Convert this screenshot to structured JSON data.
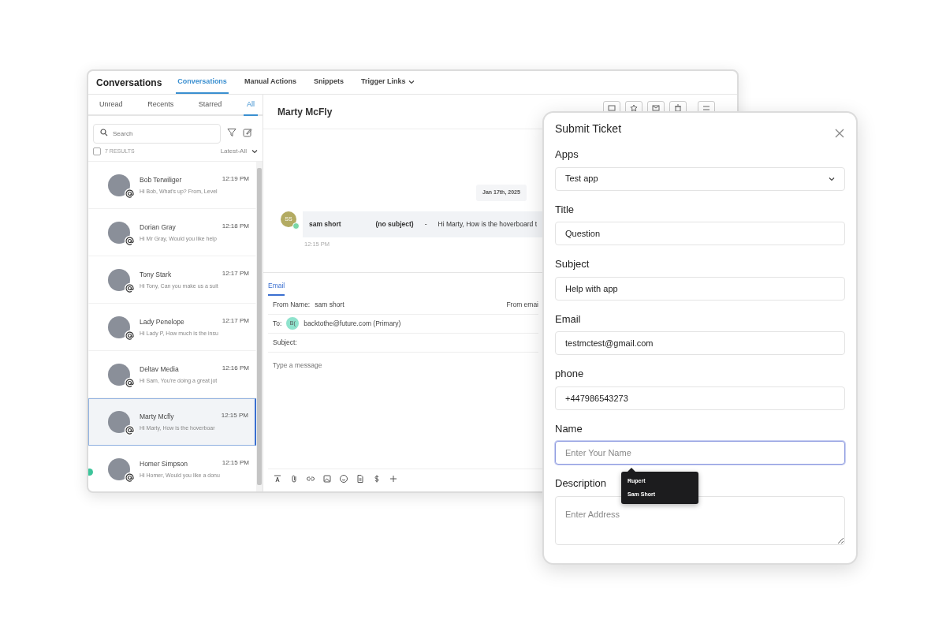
{
  "app": {
    "title": "Conversations",
    "tabs": [
      {
        "label": "Conversations",
        "selected": true,
        "kind": "plain"
      },
      {
        "label": "Manual Actions",
        "selected": false,
        "kind": "plain"
      },
      {
        "label": "Snippets",
        "selected": false,
        "kind": "plain"
      },
      {
        "label": "Trigger Links",
        "selected": false,
        "kind": "dropdown"
      }
    ]
  },
  "sidebar": {
    "filters": [
      {
        "label": "Unread",
        "selected": false
      },
      {
        "label": "Recents",
        "selected": false
      },
      {
        "label": "Starred",
        "selected": false
      },
      {
        "label": "All",
        "selected": true
      }
    ],
    "search": {
      "placeholder": "Search"
    },
    "results": {
      "label": "7 RESULTS",
      "checked": false
    },
    "sort": "Latest-All",
    "conversations": [
      {
        "name": "Bob Terwiliger",
        "time": "12:19 PM",
        "preview": "Hi Bob, What's up? From, Level",
        "selected": false,
        "online": false
      },
      {
        "name": "Dorian Gray",
        "time": "12:18 PM",
        "preview": "Hi Mr Gray, Would you like help",
        "selected": false,
        "online": false
      },
      {
        "name": "Tony Stark",
        "time": "12:17 PM",
        "preview": "Hi Tony, Can you make us a suit",
        "selected": false,
        "online": false
      },
      {
        "name": "Lady Penelope",
        "time": "12:17 PM",
        "preview": "Hi Lady P, How much is the insu",
        "selected": false,
        "online": false
      },
      {
        "name": "Deltav Media",
        "time": "12:16 PM",
        "preview": "Hi Sam, You're doing a great jot",
        "selected": false,
        "online": false
      },
      {
        "name": "Marty Mcfly",
        "time": "12:15 PM",
        "preview": "Hi Marty, How is the hoverboar",
        "selected": true,
        "online": false
      },
      {
        "name": "Homer Simpson",
        "time": "12:15 PM",
        "preview": "Hi Homer, Would you like a donu",
        "selected": false,
        "online": true
      }
    ]
  },
  "chat": {
    "contact": "Marty McFly",
    "date": "Jan 17th, 2025",
    "message": {
      "initials": "SS",
      "sender": "sam short",
      "subject": "(no subject)",
      "separator": "-",
      "body": "Hi Marty, How is the hoverboard t",
      "time": "12:15 PM"
    },
    "compose": {
      "tab": "Email",
      "from_label": "From Name:",
      "from_value": "sam short",
      "from_email_label": "From emai",
      "to_label": "To:",
      "to_initials": "B(",
      "to_value": "backtothe@future.com (Primary)",
      "subject_label": "Subject:",
      "placeholder": "Type a message"
    }
  },
  "modal": {
    "title": "Submit Ticket",
    "fields": [
      {
        "label": "Apps",
        "kind": "select",
        "value": "Test app",
        "focused": false
      },
      {
        "label": "Title",
        "kind": "text",
        "value": "Question",
        "focused": false
      },
      {
        "label": "Subject",
        "kind": "text",
        "value": "Help with app",
        "focused": false
      },
      {
        "label": "Email",
        "kind": "text",
        "value": "testmctest@gmail.com",
        "focused": false
      },
      {
        "label": "phone",
        "kind": "text",
        "value": "+447986543273",
        "focused": false
      },
      {
        "label": "Name",
        "kind": "text",
        "placeholder": "Enter Your Name",
        "focused": true
      },
      {
        "label": "Description",
        "kind": "textarea",
        "placeholder": "Enter Address",
        "focused": false
      }
    ],
    "suggestions": [
      "Rupert",
      "Sam Short"
    ]
  }
}
